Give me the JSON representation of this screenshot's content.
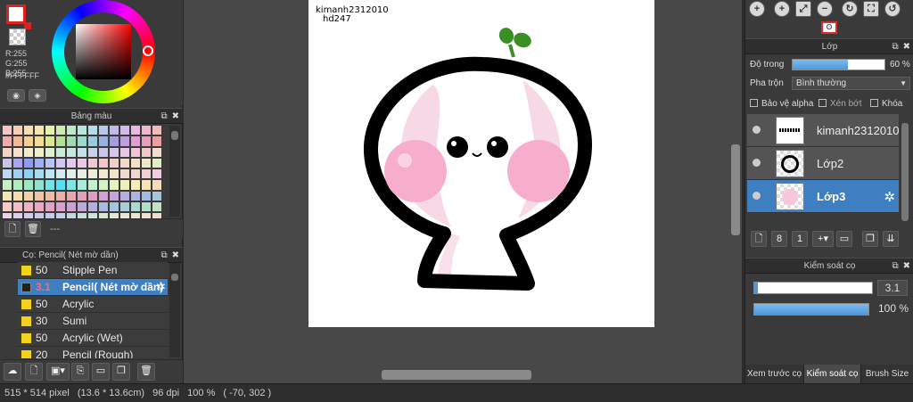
{
  "color": {
    "rgb_readout": "R:255\nG:255\nB:255",
    "hex": "#FFFFFF",
    "main_color": "#FFFFFF",
    "accent": "#E0201E"
  },
  "palette": {
    "title": "Bảng màu",
    "placeholder": "---",
    "swatches": [
      "#f5c4c4",
      "#f6cdb7",
      "#f6ddb3",
      "#f3e6b0",
      "#e6f0b0",
      "#cdeab5",
      "#bfe8c8",
      "#b8e6dd",
      "#b8dbe9",
      "#b7c8ea",
      "#c0b9ea",
      "#d5b9ea",
      "#eab9e0",
      "#f0b8cc",
      "#f3b9b9",
      "#f1a9a9",
      "#f3b996",
      "#f4cf8f",
      "#f0df8c",
      "#dbe98c",
      "#b4e096",
      "#a1dcb1",
      "#97dbcc",
      "#98cae2",
      "#97b1e3",
      "#a59de2",
      "#c19de3",
      "#e19dd4",
      "#eb9cb9",
      "#ee9d9d",
      "#f3d3c3",
      "#f4e1c7",
      "#f2eac8",
      "#eef1c8",
      "#dff0cc",
      "#cdebd4",
      "#c6e8e0",
      "#c5e0ea",
      "#c6d2ec",
      "#cac6ec",
      "#d7c6ec",
      "#e8c6e6",
      "#efc6d6",
      "#f1c7c7",
      "#f5dcd0",
      "#c9c2ea",
      "#a8a6ee",
      "#8d9cf2",
      "#9fb0f4",
      "#b9c2f4",
      "#d0c7f2",
      "#e3c8ef",
      "#ecc8e2",
      "#f0c8d4",
      "#f0c8c8",
      "#f1cfc8",
      "#f2d8c8",
      "#f2e2c8",
      "#eeeac8",
      "#e2edc8",
      "#b9d8f4",
      "#9fcff5",
      "#8ed0f0",
      "#a6def0",
      "#bfe6ef",
      "#d3ecef",
      "#e2efe8",
      "#e9efe0",
      "#edeed7",
      "#f0ead0",
      "#f2e3cc",
      "#f3dccc",
      "#f3d5cf",
      "#f2d0d6",
      "#efcddf",
      "#c7f0c2",
      "#b3ecc0",
      "#9ee8c4",
      "#8ee3d0",
      "#73e3e8",
      "#55dff0",
      "#7fe6e4",
      "#a9ecd8",
      "#c4f0cd",
      "#d7f2c4",
      "#e6f2bd",
      "#eff0b9",
      "#f4ecb9",
      "#f5e4bb",
      "#f5dcc0",
      "#f5e5b5",
      "#f4ddae",
      "#f3d2aa",
      "#f1c6a7",
      "#efbaa6",
      "#ecaea8",
      "#e8a5ae",
      "#e4a0b8",
      "#de9ec4",
      "#d4a0d0",
      "#c6a5d8",
      "#b8abdd",
      "#abb3df",
      "#a3bcde",
      "#a1c6dc",
      "#f6cac8",
      "#f3bfc4",
      "#efb3c2",
      "#e9a9c4",
      "#e2a2c8",
      "#d8a0cf",
      "#cba2d6",
      "#bda8dc",
      "#b0b0df",
      "#a8bbdf",
      "#a4c6dc",
      "#a5d0d6",
      "#abd8cf",
      "#b5dec7",
      "#c2e2c1",
      "#e6d4e8",
      "#dccfe9",
      "#d2cbe9",
      "#c9cae8",
      "#c3cce6",
      "#c1d1e3",
      "#c3d7df",
      "#c9dddb",
      "#d1e1d7",
      "#dae4d4",
      "#e3e6d3",
      "#eae6d3",
      "#efe4d4",
      "#f1e0d6",
      "#f1dbd9",
      "#f1e0e8",
      "#ece0ec",
      "#e5e0ee",
      "#dde2ef",
      "#d7e5ee",
      "#d5e9ea",
      "#d7ece5",
      "#dcede0",
      "#e3eedc",
      "#eaedda",
      "#efebd9",
      "#f2e7da",
      "#f3e3dc",
      "#f2dfe0",
      "#f0dde4"
    ]
  },
  "brush": {
    "title": "Cọ: Pencil( Nét mờ dần)",
    "items": [
      {
        "size": "50",
        "name": "Stipple Pen"
      },
      {
        "size": "3.1",
        "name": "Pencil( Nét mờ dần)"
      },
      {
        "size": "50",
        "name": "Acrylic"
      },
      {
        "size": "30",
        "name": "Sumi"
      },
      {
        "size": "50",
        "name": "Acrylic (Wet)"
      },
      {
        "size": "20",
        "name": "Pencil (Rough)"
      }
    ]
  },
  "canvas": {
    "line1": "kimanh2312010",
    "line2": "hd247"
  },
  "layer": {
    "title": "Lớp",
    "opacity_label": "Độ trong",
    "opacity_value": "60 %",
    "opacity_fraction": 0.6,
    "blend_label": "Pha trộn",
    "blend_value": "Bình thường",
    "protect_alpha": "Bảo vệ alpha",
    "clipping": "Xén bớt",
    "lock": "Khóa",
    "items": [
      {
        "name": "kimanh2312010"
      },
      {
        "name": "Lớp2"
      },
      {
        "name": "Lớp3"
      }
    ]
  },
  "control": {
    "title": "Kiểm soát cọ",
    "size_value": "3.1",
    "opacity_value": "100 %",
    "opacity_fraction": 1.0
  },
  "tabs": [
    "Xem trước cọ",
    "Kiểm soát cọ",
    "Brush Size"
  ],
  "status": {
    "pixels": "515 * 514 pixel",
    "cm": "(13.6 * 13.6cm)",
    "dpi": "96 dpi",
    "zoom": "100 %",
    "cursor": "( -70, 302 )"
  }
}
